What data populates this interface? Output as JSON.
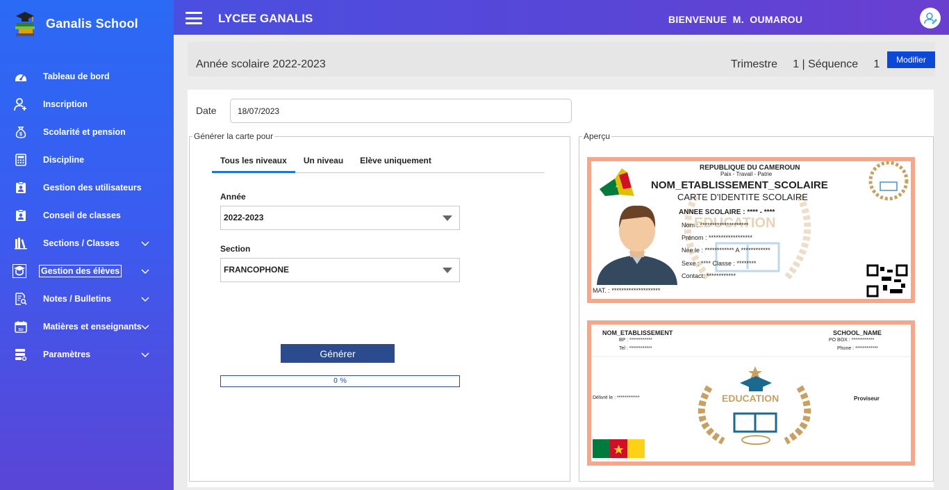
{
  "app": {
    "brand": "Ganalis School"
  },
  "sidebar": {
    "items": [
      {
        "label": "Tableau de bord",
        "icon": "dashboard-icon",
        "has_children": false
      },
      {
        "label": "Inscription",
        "icon": "user-add-icon",
        "has_children": false
      },
      {
        "label": "Scolarité et pension",
        "icon": "money-bag-icon",
        "has_children": false
      },
      {
        "label": "Discipline",
        "icon": "calculator-icon",
        "has_children": false
      },
      {
        "label": "Gestion des utilisateurs",
        "icon": "clipboard-user-icon",
        "has_children": false
      },
      {
        "label": "Conseil de classes",
        "icon": "clipboard-user-icon",
        "has_children": false
      },
      {
        "label": "Sections / Classes",
        "icon": "books-icon",
        "has_children": true
      },
      {
        "label": "Gestion des élèves",
        "icon": "student-icon",
        "has_children": true,
        "active": true
      },
      {
        "label": "Notes / Bulletins",
        "icon": "report-search-icon",
        "has_children": true
      },
      {
        "label": "Matières et enseignants",
        "icon": "calendar-icon",
        "has_children": true
      },
      {
        "label": "Paramètres",
        "icon": "settings-stack-icon",
        "has_children": true
      }
    ]
  },
  "header": {
    "school": "LYCEE GANALIS",
    "welcome": "BIENVENUE  M.  OUMAROU"
  },
  "yearbar": {
    "year": "Année scolaire 2022-2023",
    "trimestre": "Trimestre     1 | Séquence     1",
    "modify": "Modifier"
  },
  "form": {
    "date_label": "Date",
    "date_value": "18/07/2023",
    "generate_legend": "Générer la carte pour",
    "preview_legend": "Aperçu",
    "tabs": [
      "Tous les niveaux",
      "Un niveau",
      "Elève uniquement"
    ],
    "year_label": "Année",
    "year_value": "2022-2023",
    "section_label": "Section",
    "section_value": "FRANCOPHONE",
    "generate_button": "Générer",
    "progress_text": "0 %",
    "progress_value": 0
  },
  "card_front": {
    "republic": "REPUBLIQUE DU CAMEROUN",
    "motto": "Paix - Travail - Patrie",
    "school": "NOM_ETABLISSEMENT_SCOLAIRE",
    "title": "CARTE D'IDENTITE SCOLAIRE",
    "annee": "ANNEE SCOLAIRE : **** - ****",
    "nom": "Nom : ********************",
    "prenom": "Prénom : ******************",
    "nee": "Née le : ************      A  ************",
    "sexe": "Sexe : ****                        Classe : ********",
    "contact": "Contact: ************",
    "mat": "MAT. : ********************",
    "watermark": "EDUCATION"
  },
  "card_back": {
    "school_left": "NOM_ETABLISSEMENT",
    "school_right": "SCHOOL_NAME",
    "bp": "BP : ************",
    "tel": "Tel : ************",
    "pobox": "PO BOX : ************",
    "phone": "Phone : ************",
    "delivered": "Délivré le : ************",
    "proviseur": "Proviseur",
    "emblem": "EDUCATION"
  },
  "colors": {
    "sidebar_top": "#2a6af4",
    "sidebar_bottom": "#5a45d6",
    "topbar": "#5a45d6",
    "accent": "#0d47d6",
    "generate": "#2c4a8e",
    "card_border": "#f4a78a",
    "gold": "#c8a060"
  }
}
